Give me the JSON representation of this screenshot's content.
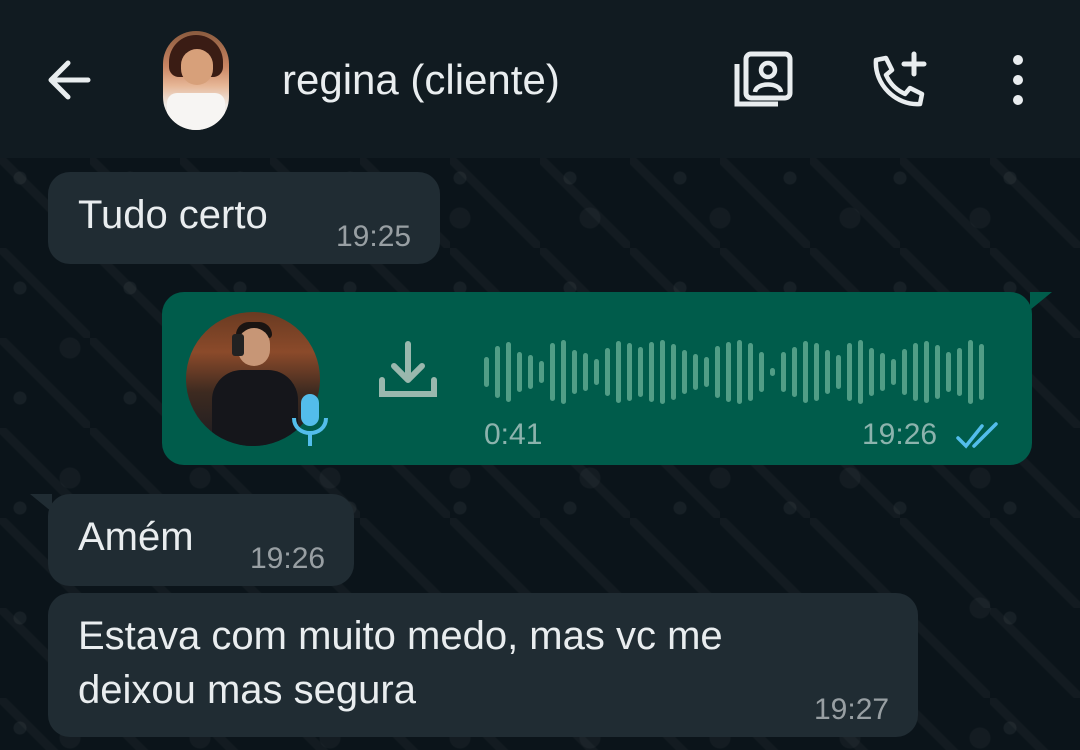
{
  "header": {
    "title": "regina (cliente)",
    "back_icon": "arrow-left-icon",
    "contacts_icon": "contact-card-icon",
    "call_icon": "call-add-icon",
    "menu_icon": "more-vert-icon"
  },
  "messages": [
    {
      "direction": "in",
      "text": "Tudo certo",
      "time": "19:25"
    },
    {
      "direction": "out",
      "type": "voice",
      "duration": "0:41",
      "time": "19:26",
      "status": "read"
    },
    {
      "direction": "in",
      "text": "Amém",
      "time": "19:26"
    },
    {
      "direction": "in",
      "text_line1": "Estava com muito medo, mas vc me",
      "text_line2": "deixou mas segura",
      "time": "19:27"
    }
  ],
  "colors": {
    "header_bg": "#111b21",
    "chat_bg": "#0b141a",
    "incoming_bubble": "#202c33",
    "outgoing_bubble": "#005c4b",
    "read_tick": "#53bdeb",
    "mic_badge": "#53bdeb"
  }
}
